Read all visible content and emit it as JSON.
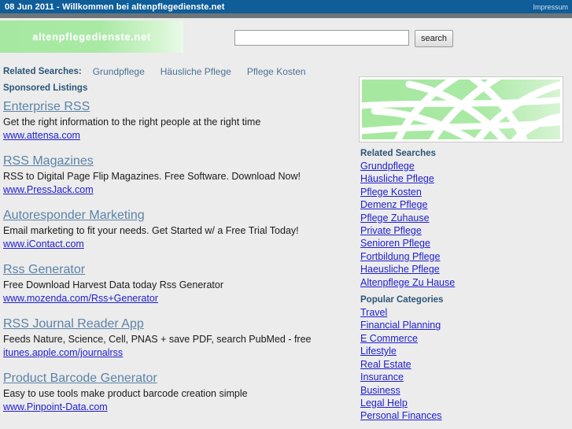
{
  "topbar": {
    "title": "08 Jun 2011 - Willkommen bei altenpflegedienste.net",
    "impressum_label": "Impressum"
  },
  "header": {
    "logo_text": "altenpflegedienste.net",
    "search": {
      "value": "",
      "placeholder": "",
      "button_label": "search"
    }
  },
  "related_strip": {
    "label": "Related Searches:",
    "links": [
      "Grundpflege",
      "Häusliche Pflege",
      "Pflege Kosten"
    ]
  },
  "main": {
    "sponsored_label": "Sponsored Listings",
    "listings": [
      {
        "title": "Enterprise RSS",
        "description": "Get the right information to the right people at the right time",
        "url": "www.attensa.com"
      },
      {
        "title": "RSS Magazines",
        "description": "RSS to Digital Page Flip Magazines. Free Software. Download Now!",
        "url": "www.PressJack.com"
      },
      {
        "title": "Autoresponder Marketing",
        "description": "Email marketing to fit your needs. Get Started w/ a Free Trial Today!",
        "url": "www.iContact.com"
      },
      {
        "title": "Rss Generator",
        "description": "Free Download Harvest Data today Rss Generator",
        "url": "www.mozenda.com/Rss+Generator"
      },
      {
        "title": "RSS Journal Reader App",
        "description": "Feeds Nature, Science, Cell, PNAS + save PDF, search PubMed - free",
        "url": "itunes.apple.com/journalrss"
      },
      {
        "title": "Product Barcode Generator",
        "description": "Easy to use tools make product barcode creation simple",
        "url": "www.Pinpoint-Data.com"
      }
    ]
  },
  "sidebar": {
    "banner_icon": "globe-graphic",
    "related_searches": {
      "heading": "Related Searches",
      "items": [
        "Grundpflege",
        "Häusliche Pflege",
        "Pflege Kosten",
        "Demenz Pflege",
        "Pflege Zuhause",
        "Private Pflege",
        "Senioren Pflege",
        "Fortbildung Pflege",
        "Haeusliche Pflege",
        "Altenpflege Zu Hause"
      ]
    },
    "popular_categories": {
      "heading": "Popular Categories",
      "items": [
        "Travel",
        "Financial Planning",
        "E Commerce",
        "Lifestyle",
        "Real Estate",
        "Insurance",
        "Business",
        "Legal Help",
        "Personal Finances"
      ]
    }
  },
  "colors": {
    "topbar_blue": "#0f5d99",
    "gray_rule": "#6e7579",
    "page_bg": "#ececec",
    "logo_green": "#a6e8a2",
    "heading_blue": "#2b5578",
    "title_link": "#5b83a8",
    "url_link": "#2020cf"
  }
}
